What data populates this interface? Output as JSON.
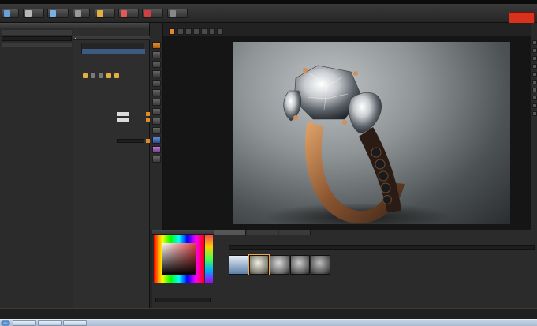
{
  "window": {
    "title": ""
  },
  "menu": {
    "items": [
      "",
      "",
      "",
      "",
      "",
      ""
    ]
  },
  "toolbar": {
    "buttons": [
      "",
      "",
      "",
      "",
      "",
      "",
      "",
      ""
    ],
    "render_button": ""
  },
  "scene_panel": {
    "title": ""
  },
  "props_panel": {
    "title": "",
    "sections": [
      ""
    ],
    "rows": {
      "diffuse_label": "",
      "specular_label": "",
      "roughness_label": ""
    }
  },
  "viewport": {
    "info": "",
    "zoom": ""
  },
  "color_panel": {
    "title": ""
  },
  "shelf": {
    "tabs": [
      "",
      "",
      ""
    ],
    "title": "",
    "breadcrumb": "",
    "thumb_labels": [
      "",
      "",
      "",
      "",
      ""
    ]
  },
  "status": {
    "left": "",
    "mid": ""
  },
  "colors": {
    "accent": "#e08a2a",
    "render": "#d8321e",
    "gold": "#b97a45"
  }
}
